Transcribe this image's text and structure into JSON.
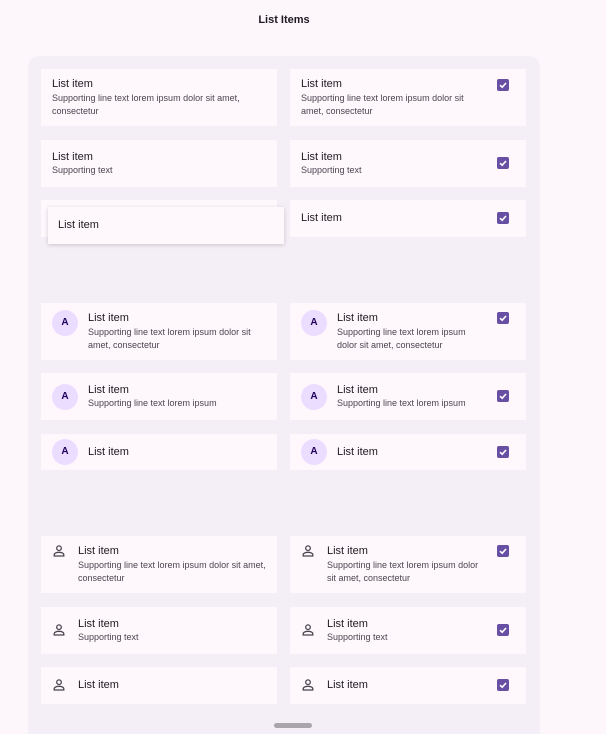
{
  "page": {
    "title": "List Items"
  },
  "text": {
    "headline": "List item",
    "support_long": "Supporting line text lorem ipsum dolor sit amet, consectetur",
    "support_medium": "Supporting line text lorem ipsum",
    "support_short": "Supporting text",
    "avatar_letter": "A"
  },
  "icons": {
    "checkbox": "checkbox-checked-icon",
    "person": "person-icon"
  },
  "colors": {
    "accent": "#6750a4",
    "avatar_bg": "#eaddff",
    "avatar_fg": "#21005d",
    "background": "#fdf7fc",
    "panel": "#f4eef6",
    "card": "#fef8fd"
  },
  "checkboxes_checked": true
}
